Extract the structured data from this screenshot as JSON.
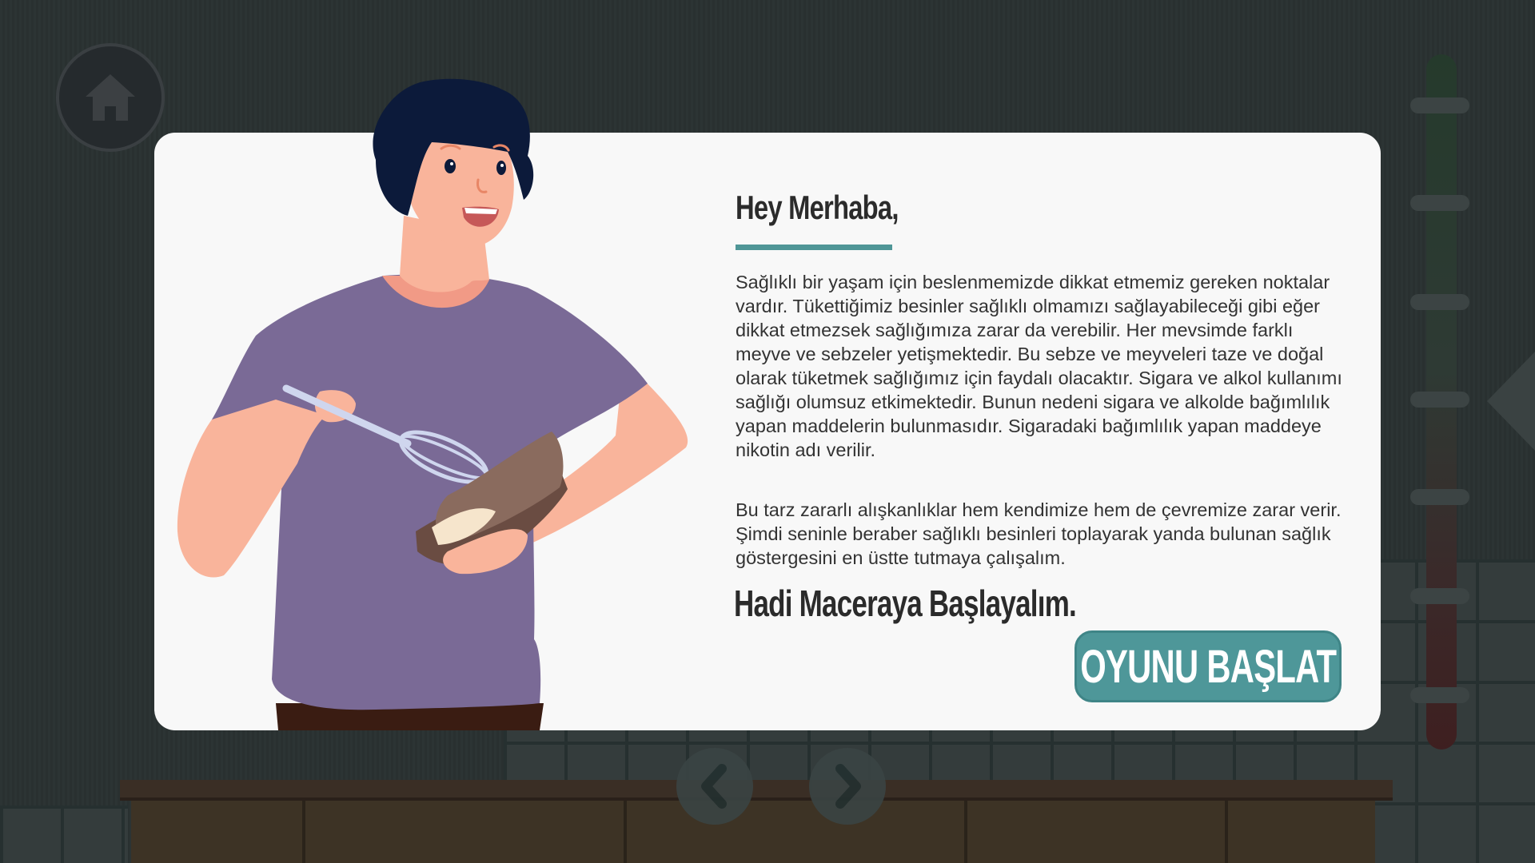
{
  "dialog": {
    "title": "Hey Merhaba,",
    "paragraph_1": "Sağlıklı bir yaşam için beslenmemizde dikkat etmemiz gereken noktalar vardır. Tükettiğimiz besinler sağlıklı olmamızı sağlayabileceği gibi eğer dikkat etmezsek sağlığımıza zarar da verebilir. Her mevsimde farklı meyve ve sebzeler yetişmektedir. Bu sebze ve meyveleri taze ve doğal olarak tüketmek sağlığımız için faydalı olacaktır. Sigara ve alkol kullanımı sağlığı olumsuz etkimektedir. Bunun nedeni sigara ve alkolde bağımlılık yapan maddelerin bulunmasıdır. Sigaradaki bağımlılık yapan maddeye nikotin adı verilir.",
    "paragraph_2": "Bu tarz zararlı alışkanlıklar hem kendimize hem de çevremize zarar verir. Şimdi seninle beraber sağlıklı besinleri toplayarak yanda bulunan sağlık göstergesini en üstte tutmaya çalışalım.",
    "cta": "Hadi Maceraya Başlayalım.",
    "start_button_label": "OYUNU BAŞLAT"
  },
  "icons": {
    "home": "home-icon",
    "prev": "chevron-left-icon",
    "next": "chevron-right-icon"
  },
  "colors": {
    "accent": "#4e9799",
    "background": "#2a3232",
    "dialog": "#f8f8f8",
    "shirt": "#7a6a96"
  }
}
